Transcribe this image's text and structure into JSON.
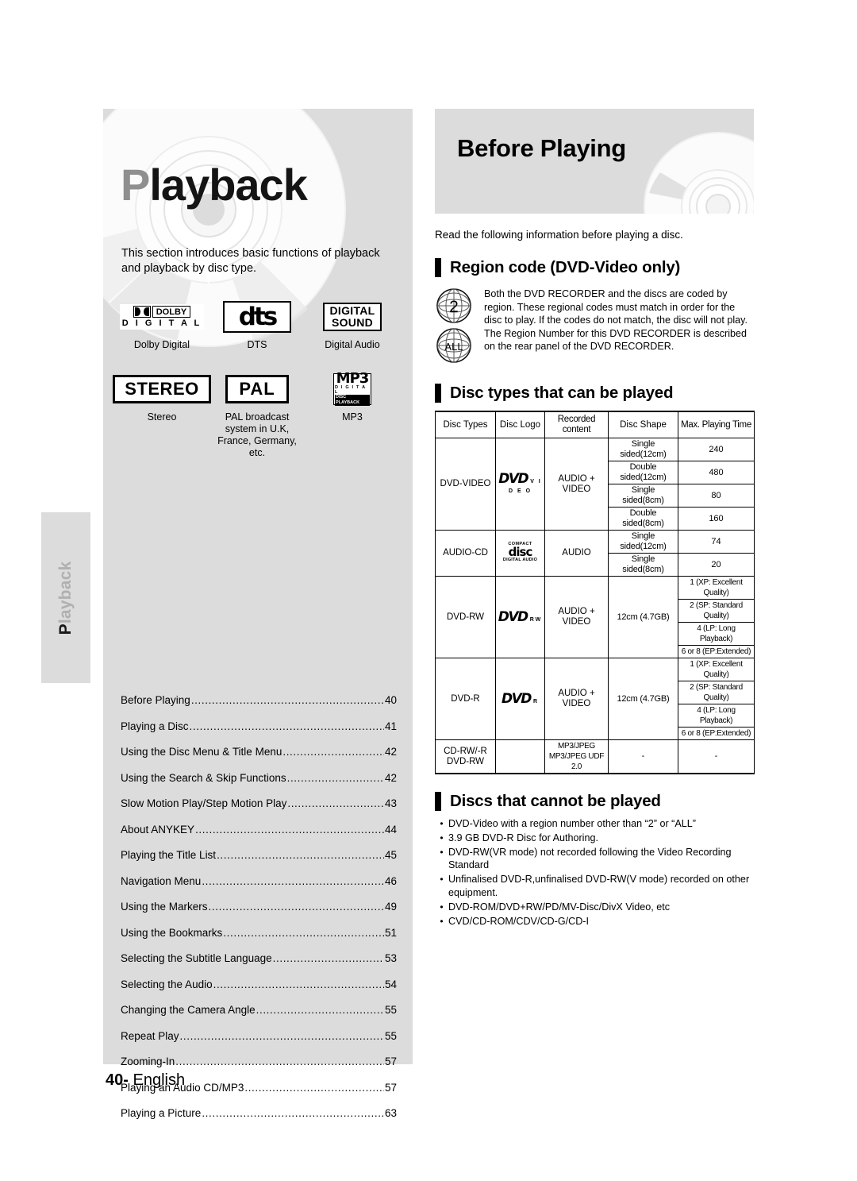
{
  "side_tab": {
    "cap": "P",
    "rest": "layback"
  },
  "left": {
    "title_cap": "P",
    "title_rest": "layback",
    "intro": "This section introduces basic functions of playback and playback by disc type.",
    "logos": [
      {
        "name": "dolby-digital-logo",
        "caption": "Dolby Digital",
        "word": "DOLBY",
        "sub": "D I G I T A L"
      },
      {
        "name": "dts-logo",
        "caption": "DTS",
        "text": "dts"
      },
      {
        "name": "digital-sound-logo",
        "caption": "Digital Audio",
        "line1": "DIGITAL",
        "line2": "SOUND"
      },
      {
        "name": "stereo-logo",
        "caption": "Stereo",
        "text": "STEREO"
      },
      {
        "name": "pal-logo",
        "caption": "PAL broadcast system in U.K, France, Germany, etc.",
        "text": "PAL"
      },
      {
        "name": "mp3-logo",
        "caption": "MP3",
        "big": "MP3",
        "sub1": "D I G I T A L",
        "sub2": "DISC PLAYBACK"
      }
    ],
    "toc": [
      {
        "label": "Before Playing",
        "page": "40"
      },
      {
        "label": "Playing a Disc",
        "page": "41"
      },
      {
        "label": "Using the Disc Menu & Title Menu",
        "page": "42"
      },
      {
        "label": "Using the Search & Skip Functions",
        "page": "42"
      },
      {
        "label": "Slow Motion Play/Step Motion Play",
        "page": "43"
      },
      {
        "label": "About ANYKEY",
        "page": "44"
      },
      {
        "label": "Playing the Title List",
        "page": "45"
      },
      {
        "label": "Navigation Menu",
        "page": "46"
      },
      {
        "label": "Using the Markers",
        "page": "49"
      },
      {
        "label": "Using the Bookmarks",
        "page": "51"
      },
      {
        "label": "Selecting the Subtitle Language",
        "page": "53"
      },
      {
        "label": "Selecting the Audio",
        "page": "54"
      },
      {
        "label": "Changing the Camera Angle",
        "page": "55"
      },
      {
        "label": "Repeat Play",
        "page": "55"
      },
      {
        "label": "Zooming-In",
        "page": "57"
      },
      {
        "label": "Playing an Audio CD/MP3",
        "page": "57"
      },
      {
        "label": "Playing a Picture",
        "page": "63"
      }
    ]
  },
  "footer": {
    "page_number": "40",
    "dash": "-",
    "language": "English"
  },
  "right": {
    "banner_title": "Before Playing",
    "read_note": "Read the following information before playing a disc.",
    "region": {
      "heading": "Region code (DVD-Video only)",
      "globe_1": "2",
      "globe_2": "ALL",
      "body": "Both the DVD RECORDER and the discs are coded by region. These regional codes must match in order for the disc to play. If the codes do not match, the disc will not play. The Region Number for this DVD RECORDER is described on the rear panel of the DVD RECORDER."
    },
    "disc_types": {
      "heading": "Disc types that can be played",
      "columns": [
        "Disc Types",
        "Disc Logo",
        "Recorded content",
        "Disc Shape",
        "Max. Playing Time"
      ],
      "rows": [
        {
          "type": "DVD-VIDEO",
          "logo_top": "DVD",
          "logo_sub": "V I D E O",
          "recorded": "AUDIO + VIDEO",
          "shapes": [
            "Single sided(12cm)",
            "Double sided(12cm)",
            "Single sided(8cm)",
            "Double sided(8cm)"
          ],
          "times": [
            "240",
            "480",
            "80",
            "160"
          ]
        },
        {
          "type": "AUDIO-CD",
          "logo_top": "COMPACT",
          "logo_mid": "disc",
          "logo_sub": "DIGITAL AUDIO",
          "recorded": "AUDIO",
          "shapes": [
            "Single sided(12cm)",
            "Single sided(8cm)"
          ],
          "times": [
            "74",
            "20"
          ]
        },
        {
          "type": "DVD-RW",
          "logo_top": "DVD",
          "logo_sub": "RW",
          "recorded": "AUDIO + VIDEO",
          "shape_single": "12cm (4.7GB)",
          "times": [
            "1 (XP: Excellent Quality)",
            "2 (SP: Standard Quality)",
            "4 (LP: Long Playback)",
            "6 or 8 (EP:Extended)"
          ]
        },
        {
          "type": "DVD-R",
          "logo_top": "DVD",
          "logo_sub": "R",
          "recorded": "AUDIO + VIDEO",
          "shape_single": "12cm (4.7GB)",
          "times": [
            "1 (XP: Excellent Quality)",
            "2 (SP: Standard Quality)",
            "4 (LP: Long Playback)",
            "6 or 8 (EP:Extended)"
          ]
        },
        {
          "type_line1": "CD-RW/-R",
          "type_line2": "DVD-RW",
          "recorded_line1": "MP3/JPEG",
          "recorded_line2": "MP3/JPEG UDF 2.0",
          "shape": "-",
          "time": "-"
        }
      ]
    },
    "cannot_play": {
      "heading": "Discs that cannot be played",
      "bullet": "•",
      "items": [
        "DVD-Video with a region number other than “2” or “ALL”",
        "3.9 GB DVD-R Disc for Authoring.",
        "DVD-RW(VR mode) not recorded following the Video Recording Standard",
        "Unfinalised DVD-R,unfinalised DVD-RW(V mode) recorded on other equipment.",
        "DVD-ROM/DVD+RW/PD/MV-Disc/DivX Video, etc",
        "CVD/CD-ROM/CDV/CD-G/CD-I"
      ]
    }
  },
  "colors": {
    "panel_gray": "#dcdcdc",
    "tab_text_gray": "#b0b0b0",
    "title_cap_gray": "#8f8f8f"
  }
}
